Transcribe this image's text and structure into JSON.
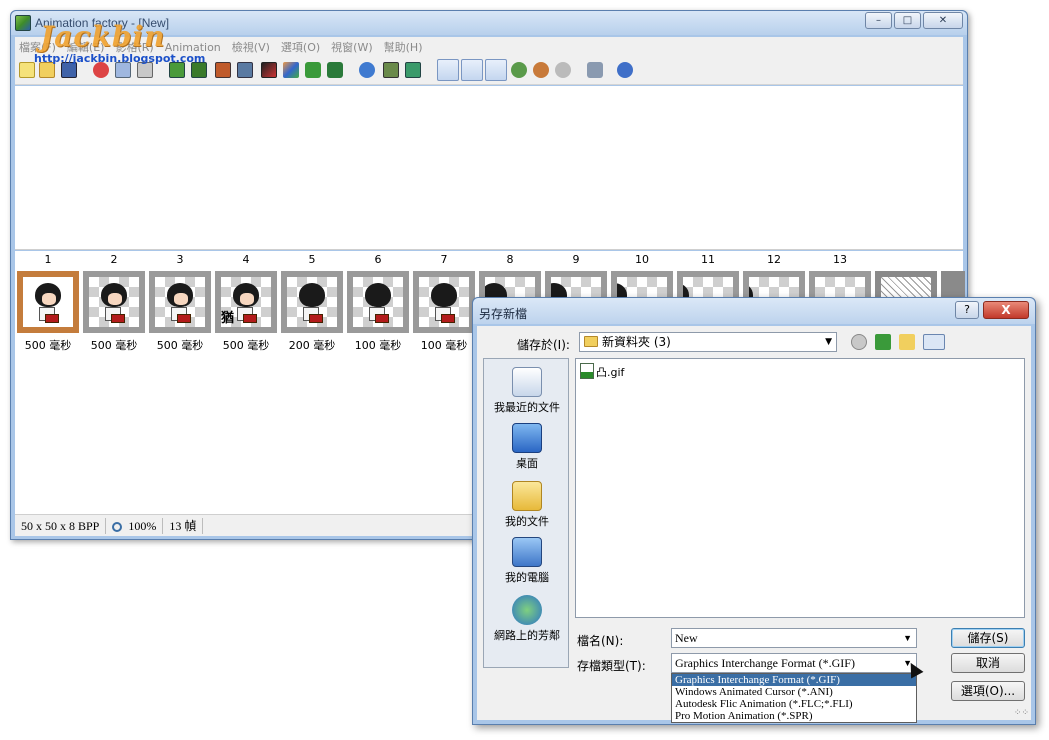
{
  "main_window": {
    "title": "Animation factory - [New]",
    "menu": [
      "檔案(F)",
      "編輯(E)",
      "影格(R)",
      "Animation",
      "檢視(V)",
      "選項(O)",
      "視窗(W)",
      "幫助(H)"
    ],
    "frames": [
      {
        "number": "1",
        "delay": "500 毫秒"
      },
      {
        "number": "2",
        "delay": "500 毫秒"
      },
      {
        "number": "3",
        "delay": "500 毫秒"
      },
      {
        "number": "4",
        "delay": "500 毫秒"
      },
      {
        "number": "5",
        "delay": "200 毫秒"
      },
      {
        "number": "6",
        "delay": "100 毫秒"
      },
      {
        "number": "7",
        "delay": "100 毫秒"
      },
      {
        "number": "8",
        "delay": ""
      },
      {
        "number": "9",
        "delay": ""
      },
      {
        "number": "10",
        "delay": ""
      },
      {
        "number": "11",
        "delay": ""
      },
      {
        "number": "12",
        "delay": ""
      },
      {
        "number": "13",
        "delay": ""
      }
    ],
    "frame_4_caption": "猶",
    "status": {
      "size": "50 x 50 x 8 BPP",
      "zoom": "100%",
      "frames": "13 幀"
    }
  },
  "watermark": {
    "logo": "Jackbin",
    "url": "http://jackbin.blogspot.com"
  },
  "save_dialog": {
    "title": "另存新檔",
    "help_label": "?",
    "close_label": "X",
    "look_in_label": "儲存於(I):",
    "look_in_value": "新資料夾 (3)",
    "places": [
      "我最近的文件",
      "桌面",
      "我的文件",
      "我的電腦",
      "網路上的芳鄰"
    ],
    "files": [
      {
        "name": "凸.gif"
      }
    ],
    "filename_label": "檔名(N):",
    "filename_value": "New",
    "filetype_label": "存檔類型(T):",
    "filetype_value": "Graphics Interchange Format (*.GIF)",
    "filetype_options": [
      "Graphics Interchange Format (*.GIF)",
      "Windows Animated Cursor (*.ANI)",
      "Autodesk Flic Animation (*.FLC;*.FLI)",
      "Pro Motion Animation (*.SPR)"
    ],
    "save_button": "儲存(S)",
    "cancel_button": "取消",
    "options_button": "選項(O)..."
  }
}
